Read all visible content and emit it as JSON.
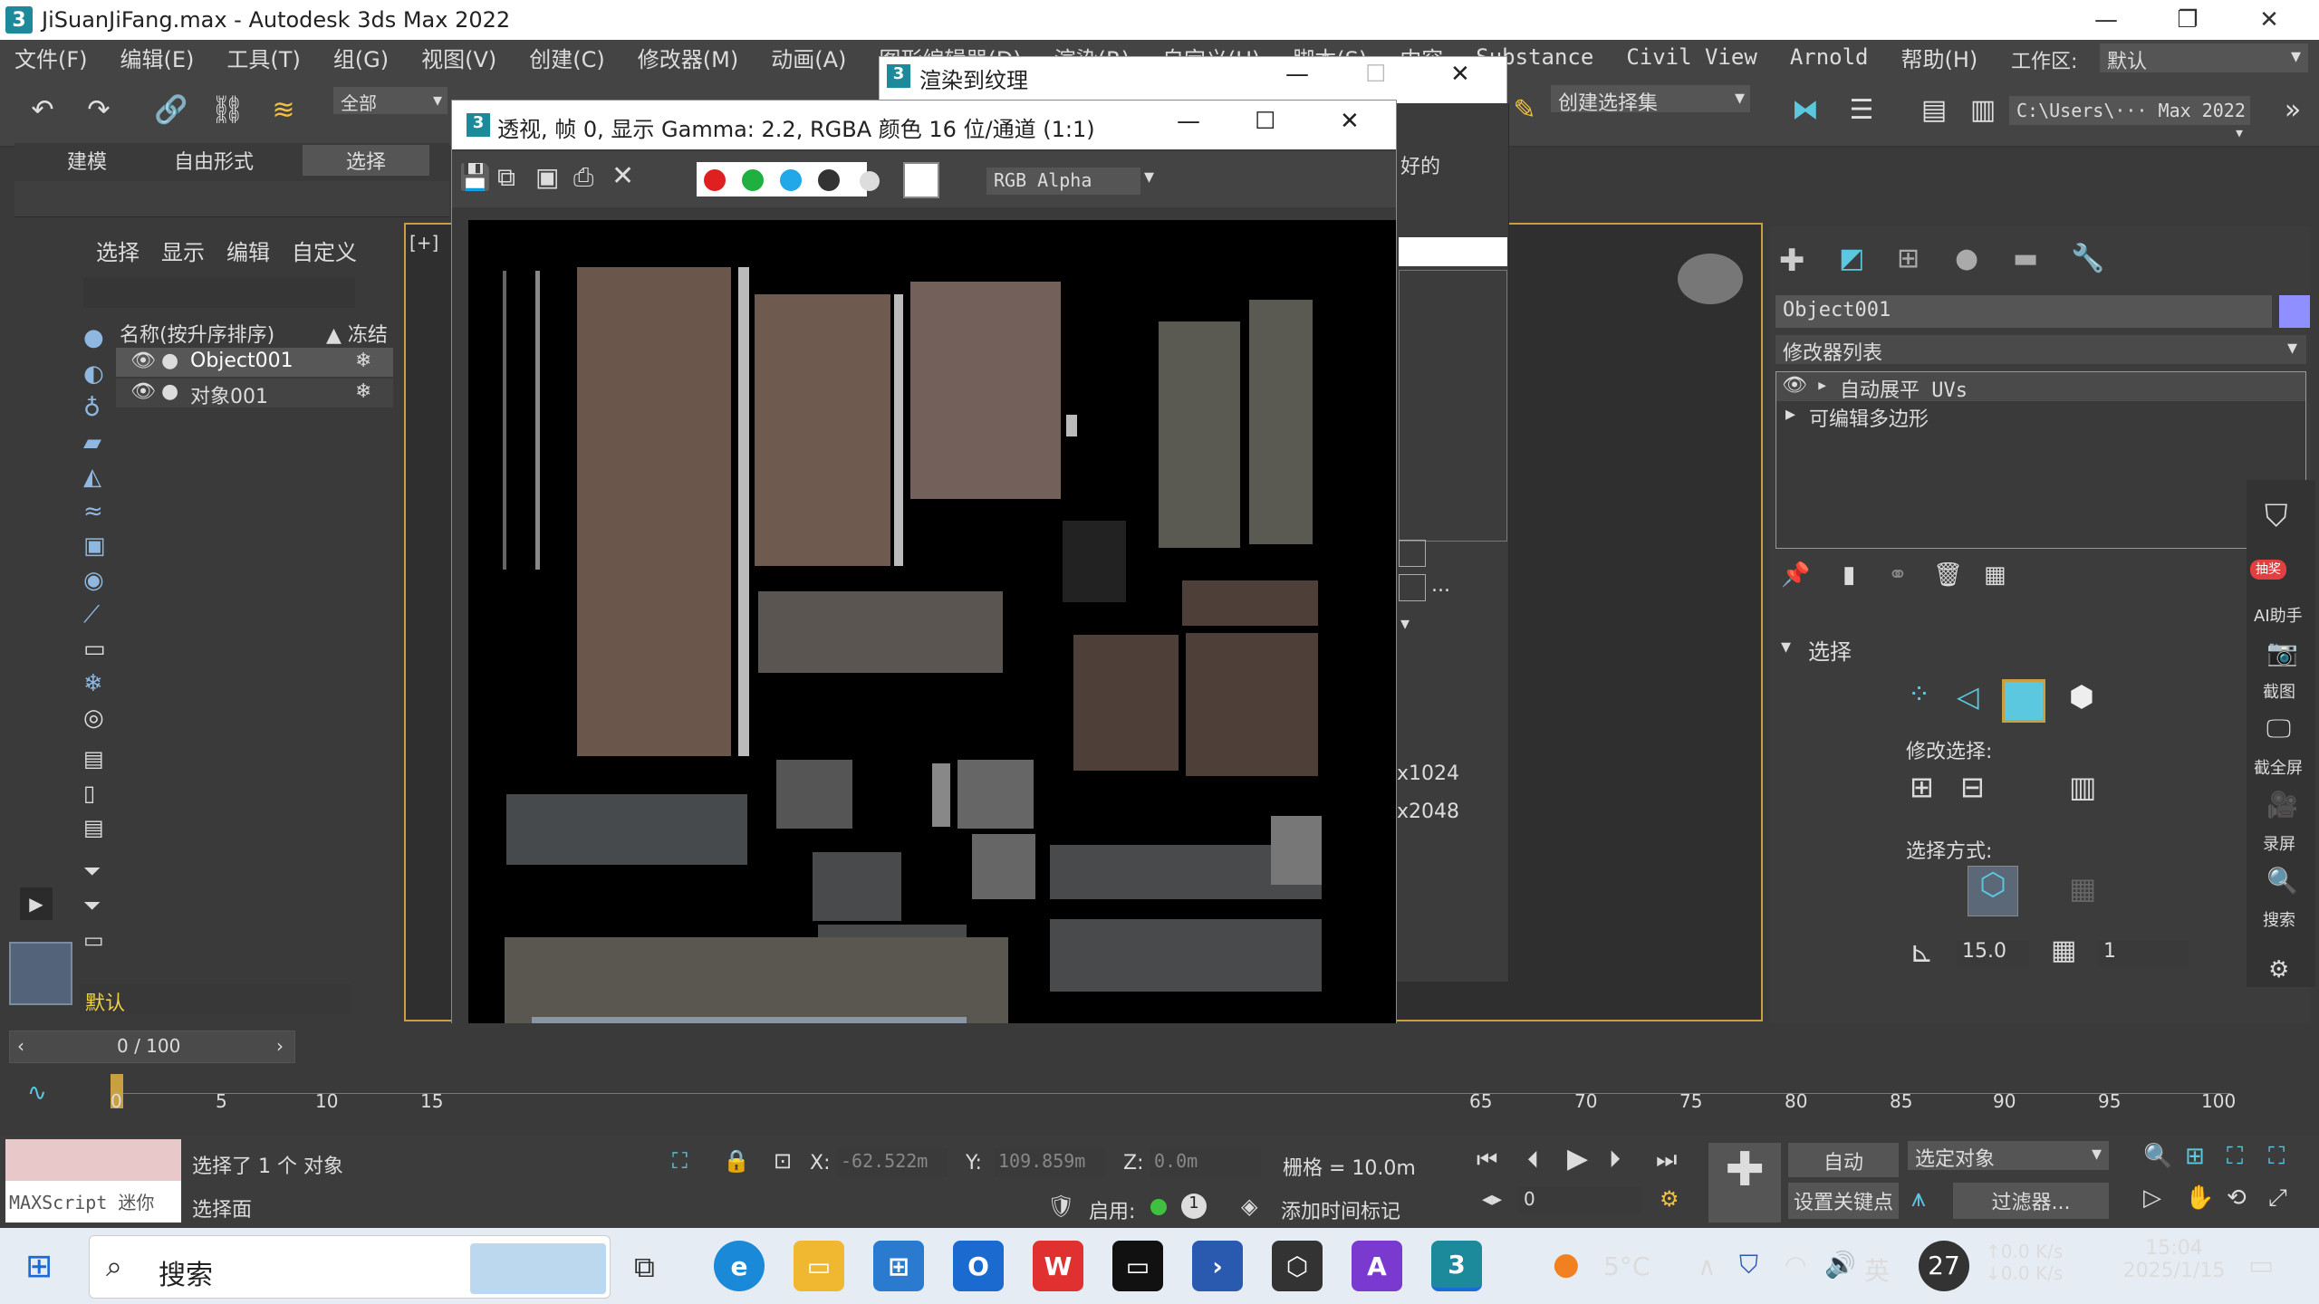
{
  "window": {
    "title": "JiSuanJiFang.max - Autodesk 3ds Max 2022",
    "logo": "3"
  },
  "menu": [
    "文件(F)",
    "编辑(E)",
    "工具(T)",
    "组(G)",
    "视图(V)",
    "创建(C)",
    "修改器(M)",
    "动画(A)",
    "图形编辑器(D)",
    "渲染(R)",
    "自定义(U)",
    "脚本(S)",
    "内容",
    "Substance",
    "Civil View",
    "Arnold",
    "帮助(H)"
  ],
  "workspace": {
    "label": "工作区:",
    "value": "默认"
  },
  "toolbar": {
    "filter": "全部",
    "selection_set": "创建选择集",
    "path": "C:\\Users\\··· Max 2022"
  },
  "ribbon_tabs": [
    "建模",
    "自由形式",
    "选择"
  ],
  "scene_explorer": {
    "menu": [
      "选择",
      "显示",
      "编辑",
      "自定义"
    ],
    "col_name": "名称(按升序排序)",
    "col_freeze": "▲ 冻结",
    "rows": [
      "Object001",
      "对象001"
    ],
    "layer": "默认"
  },
  "viewport_label": "[+]",
  "render_to_texture": {
    "title": "渲染到纹理",
    "partial_text": "好的",
    "sizes": [
      "x1024",
      "x2048"
    ],
    "ellipsis": "..."
  },
  "frame_window": {
    "title": "透视, 帧 0, 显示 Gamma: 2.2, RGBA 颜色 16 位/通道 (1:1)",
    "channel": "RGB Alpha"
  },
  "command_panel": {
    "object_name": "Object001",
    "modifier_list": "修改器列表",
    "stack": [
      "自动展平 UVs",
      "可编辑多边形"
    ],
    "rollout": "选择",
    "modify_selection": "修改选择:",
    "select_by": "选择方式:",
    "angle": "15.0",
    "count": "1",
    "side_items": [
      "AI助手",
      "截图",
      "截全屏",
      "录屏",
      "搜索"
    ],
    "badge": "抽奖"
  },
  "timeline": {
    "counter": "0 / 100",
    "ticks": [
      "0",
      "5",
      "10",
      "15",
      "65",
      "70",
      "75",
      "80",
      "85",
      "90",
      "95",
      "100"
    ]
  },
  "status": {
    "maxscript": "MAXScript 迷你",
    "selected": "选择了 1 个 对象",
    "prompt": "选择面",
    "x_label": "X:",
    "x_val": "-62.522m",
    "y_label": "Y:",
    "y_val": "109.859m",
    "z_label": "Z:",
    "z_val": "0.0m",
    "grid": "栅格 = 10.0m",
    "enable": "启用:",
    "add_time_tag": "添加时间标记",
    "auto": "自动",
    "selected_obj": "选定对象",
    "set_key": "设置关键点",
    "filters": "过滤器...",
    "frame": "0"
  },
  "taskbar": {
    "search": "搜索",
    "weather": "5°C",
    "ime": "英",
    "badge": "27",
    "net_up": "0.0",
    "net_down": "0.0",
    "net_unit": "K/s",
    "time": "15:04",
    "date": "2025/1/15"
  }
}
